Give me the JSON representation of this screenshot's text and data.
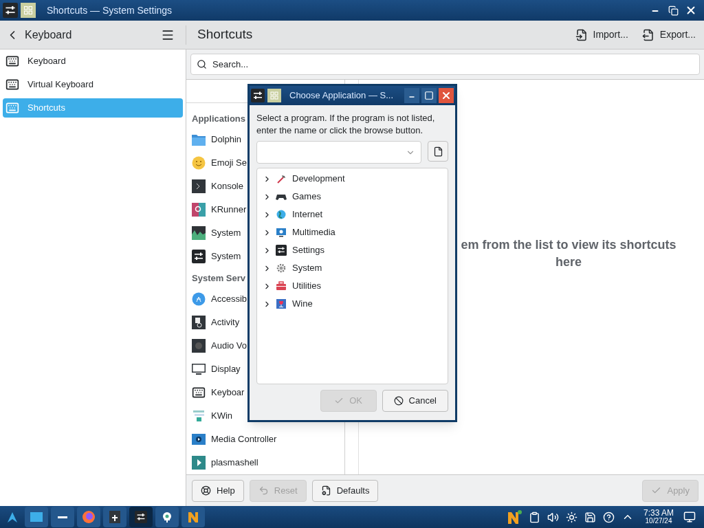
{
  "window": {
    "title": "Shortcuts — System Settings"
  },
  "sidebar": {
    "back_title": "Keyboard",
    "items": [
      {
        "label": "Keyboard",
        "selected": false
      },
      {
        "label": "Virtual Keyboard",
        "selected": false
      },
      {
        "label": "Shortcuts",
        "selected": true
      }
    ]
  },
  "header": {
    "title": "Shortcuts",
    "actions": [
      "Import...",
      "Export..."
    ]
  },
  "search": {
    "placeholder": "Search..."
  },
  "list": {
    "sections": [
      {
        "title": "Applications",
        "items": [
          "Dolphin",
          "Emoji Se",
          "Konsole",
          "KRunner",
          "System",
          "System"
        ]
      },
      {
        "title": "System Serv",
        "items": [
          "Accessib",
          "Activity",
          "Audio Vo",
          "Display",
          "Keyboar",
          "KWin",
          "Media Controller",
          "plasmashell"
        ]
      }
    ]
  },
  "right_panel": {
    "message": "em from the list to view its shortcuts here"
  },
  "footer": {
    "buttons": [
      {
        "label": "Help",
        "disabled": false
      },
      {
        "label": "Reset",
        "disabled": true
      },
      {
        "label": "Defaults",
        "disabled": false
      }
    ],
    "apply": {
      "label": "Apply",
      "disabled": true
    }
  },
  "dialog": {
    "title": "Choose Application — S...",
    "prompt": "Select a program. If the program is not listed, enter the name or click the browse button.",
    "tree": [
      {
        "label": "Development",
        "expanded": false
      },
      {
        "label": "Games",
        "expanded": false
      },
      {
        "label": "Internet",
        "expanded": false
      },
      {
        "label": "Multimedia",
        "expanded": false
      },
      {
        "label": "Settings",
        "expanded": false
      },
      {
        "label": "System",
        "expanded": false
      },
      {
        "label": "Utilities",
        "expanded": false
      },
      {
        "label": "Wine",
        "expanded": false
      }
    ],
    "buttons": [
      {
        "label": "OK",
        "disabled": true
      },
      {
        "label": "Cancel",
        "disabled": false
      }
    ]
  },
  "taskbar": {
    "time": "7:33 AM",
    "date": "10/27/24"
  }
}
